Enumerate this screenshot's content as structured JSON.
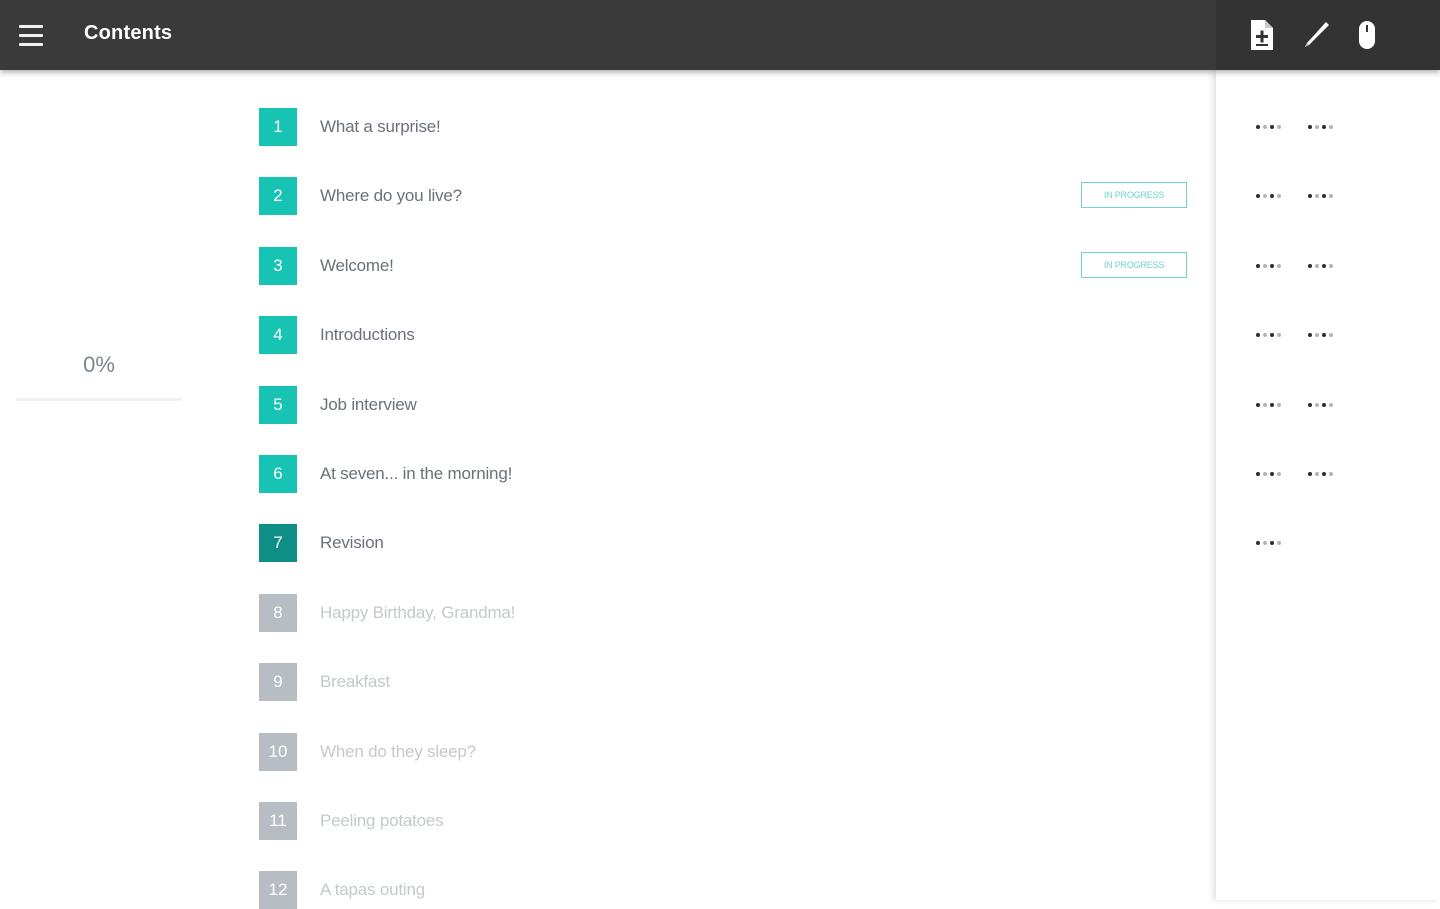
{
  "header": {
    "title": "Contents",
    "menu_icon": "hamburger-menu-icon",
    "tools": [
      {
        "name": "document-icon"
      },
      {
        "name": "pencil-icon"
      },
      {
        "name": "mouse-icon"
      }
    ]
  },
  "progress": {
    "label": "0%",
    "value": 0
  },
  "lessons": [
    {
      "number": "1",
      "title": "What a surprise!",
      "state": "done",
      "badge": "",
      "dots": 2
    },
    {
      "number": "2",
      "title": "Where do you live?",
      "state": "done",
      "badge": "IN PROGRESS",
      "dots": 2
    },
    {
      "number": "3",
      "title": "Welcome!",
      "state": "done",
      "badge": "IN PROGRESS",
      "dots": 2
    },
    {
      "number": "4",
      "title": "Introductions",
      "state": "done",
      "badge": "",
      "dots": 2
    },
    {
      "number": "5",
      "title": "Job interview",
      "state": "done",
      "badge": "",
      "dots": 2
    },
    {
      "number": "6",
      "title": "At seven... in the morning!",
      "state": "done",
      "badge": "",
      "dots": 2
    },
    {
      "number": "7",
      "title": "Revision",
      "state": "current",
      "badge": "",
      "dots": 1
    },
    {
      "number": "8",
      "title": "Happy Birthday, Grandma!",
      "state": "locked",
      "badge": "",
      "dots": 0
    },
    {
      "number": "9",
      "title": "Breakfast",
      "state": "locked",
      "badge": "",
      "dots": 0
    },
    {
      "number": "10",
      "title": "When do they sleep?",
      "state": "locked",
      "badge": "",
      "dots": 0
    },
    {
      "number": "11",
      "title": "Peeling potatoes",
      "state": "locked",
      "badge": "",
      "dots": 0
    },
    {
      "number": "12",
      "title": "A tapas outing",
      "state": "locked",
      "badge": "",
      "dots": 0
    }
  ],
  "colors": {
    "topbar": "#3a3a3a",
    "accent": "#17c3b2",
    "current": "#0e8e84",
    "locked": "#b7bdc2"
  }
}
